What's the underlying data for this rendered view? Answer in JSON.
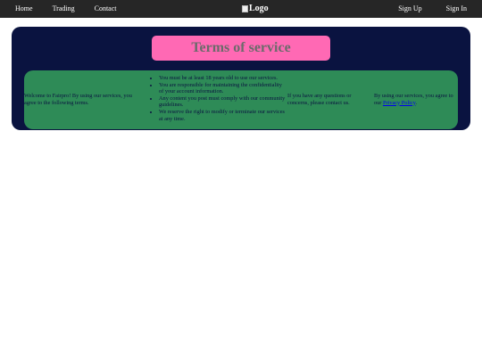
{
  "nav": {
    "home": "Home",
    "trading": "Trading",
    "contact": "Contact",
    "logo_alt": "Logo",
    "signup": "Sign Up",
    "signin": "Sign In"
  },
  "page": {
    "title": "Terms of service"
  },
  "terms": {
    "intro": "Welcome to Fairpro! By using our services, you agree to the following terms.",
    "items": [
      "You must be at least 18 years old to use our services.",
      "You are responsible for maintaining the confidentiality of your account information.",
      "Any content you post must comply with our community guidelines.",
      "We reserve the right to modify or terminate our services at any time."
    ],
    "contact_text": "If you have any questions or concerns, please contact us.",
    "privacy_prefix": "By using our services, you agree to our ",
    "privacy_link": "Privacy Policy",
    "privacy_suffix": "."
  },
  "colors": {
    "nav_bg": "#262626",
    "panel_bg": "#0a1340",
    "title_bg": "#ff69b4",
    "title_text": "#6b6b6b",
    "content_bg": "#2e8b57",
    "link": "#0000ee"
  }
}
